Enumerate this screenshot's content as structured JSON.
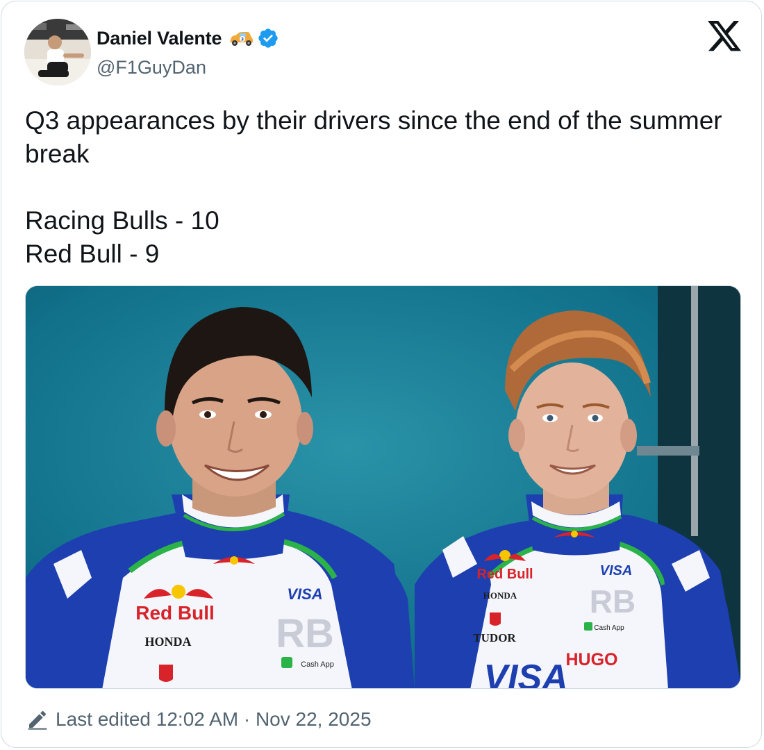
{
  "author": {
    "display_name": "Daniel Valente",
    "name_emoji": "racing-car-emoji",
    "verified_icon": "verified-badge-icon",
    "handle": "@F1GuyDan",
    "avatar": "profile-photo"
  },
  "brand": {
    "logo": "x-logo-icon"
  },
  "tweet": {
    "line1": "Q3 appearances by their drivers since the end of the summer break",
    "line2": "Racing Bulls - 10",
    "line3": "Red Bull - 9"
  },
  "media": {
    "description_icon": "photo-of-two-drivers",
    "suit_texts": {
      "left_redbull": "Red Bull",
      "left_honda": "HONDA",
      "left_visa": "VISA",
      "left_cashapp": "Cash App",
      "right_redbull": "Red Bull",
      "right_honda": "HONDA",
      "right_visa": "VISA",
      "right_tudor": "TUDOR",
      "right_hugo": "HUGO",
      "right_cashapp": "Cash App"
    }
  },
  "footer": {
    "edit_icon": "pencil-icon",
    "edited_label": "Last edited 12:02 AM · Nov 22, 2025"
  },
  "colors": {
    "text_primary": "#0f1419",
    "text_secondary": "#536471",
    "verified_blue": "#1d9bf0",
    "border": "#cfd9de",
    "backdrop_teal": "#16798f",
    "suit_blue": "#1d3fb0",
    "suit_green": "#2bb34a",
    "redbull_red": "#d8232a"
  }
}
